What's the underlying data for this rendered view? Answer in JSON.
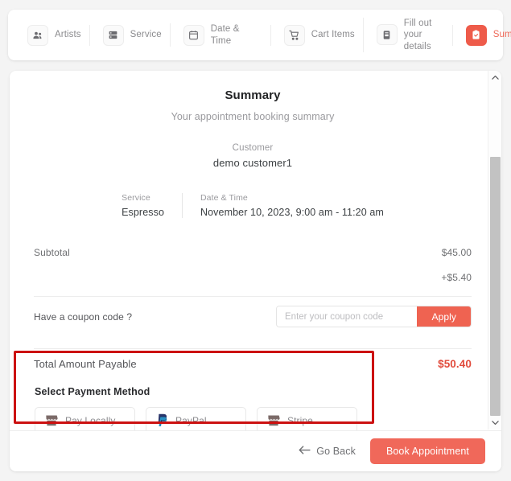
{
  "stepper": {
    "steps": [
      {
        "label": "Artists",
        "icon": "people-icon",
        "active": false
      },
      {
        "label": "Service",
        "icon": "service-list-icon",
        "active": false
      },
      {
        "label": "Date & Time",
        "icon": "calendar-icon",
        "active": false
      },
      {
        "label": "Cart Items",
        "icon": "cart-icon",
        "active": false
      },
      {
        "label": "Fill out your details",
        "icon": "form-icon",
        "active": false
      },
      {
        "label": "Summary",
        "icon": "clipboard-check-icon",
        "active": true
      }
    ]
  },
  "summary": {
    "title": "Summary",
    "subtitle": "Your appointment booking summary",
    "customer_label": "Customer",
    "customer_value": "demo customer1",
    "service_label": "Service",
    "service_value": "Espresso",
    "datetime_label": "Date & Time",
    "datetime_value": "November 10, 2023, 9:00 am - 11:20 am"
  },
  "totals": {
    "subtotal_label": "Subtotal",
    "subtotal_amount": "$45.00",
    "extra_amount": "+$5.40",
    "grand_label": "Total Amount Payable",
    "grand_amount": "$50.40"
  },
  "coupon": {
    "question": "Have a coupon code ?",
    "placeholder": "Enter your coupon code",
    "value": "",
    "apply_label": "Apply"
  },
  "payment": {
    "title": "Select Payment Method",
    "options": [
      {
        "label": "Pay Locally",
        "icon": "storefront-icon"
      },
      {
        "label": "PayPal",
        "icon": "paypal-icon"
      },
      {
        "label": "Stripe",
        "icon": "storefront-icon"
      }
    ],
    "highlight_color": "#cc1111"
  },
  "footer": {
    "back_label": "Go Back",
    "book_label": "Book Appointment"
  },
  "colors": {
    "accent": "#ef6351",
    "accent_button": "#f0685a",
    "total_amount": "#e14b3c",
    "page_background": "#f4f4f4",
    "card_background": "#ffffff"
  }
}
